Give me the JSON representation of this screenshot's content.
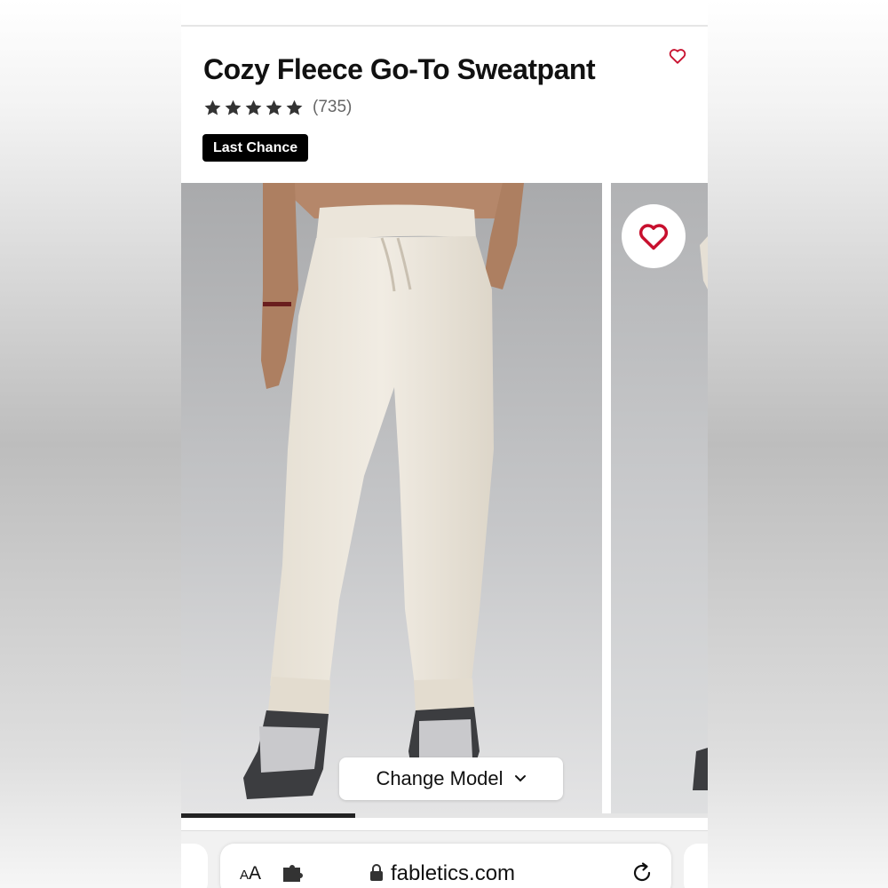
{
  "product": {
    "title": "Cozy Fleece Go-To Sweatpant",
    "rating": {
      "stars": 5,
      "count": "(735)"
    },
    "badge": "Last Chance"
  },
  "gallery": {
    "change_model_label": "Change Model",
    "progress": 0.33
  },
  "browser": {
    "text_size_label_big": "A",
    "text_size_label_small": "A",
    "url": "fabletics.com"
  },
  "icons": {
    "favorite": "heart-outline-icon",
    "rating": "star-icon",
    "dropdown": "chevron-down-icon",
    "extensions": "puzzle-icon",
    "secure": "lock-icon",
    "reload": "reload-icon"
  },
  "colors": {
    "heart": "#c8102e",
    "badge_bg": "#000000",
    "badge_text": "#ffffff",
    "star": "#333333"
  }
}
